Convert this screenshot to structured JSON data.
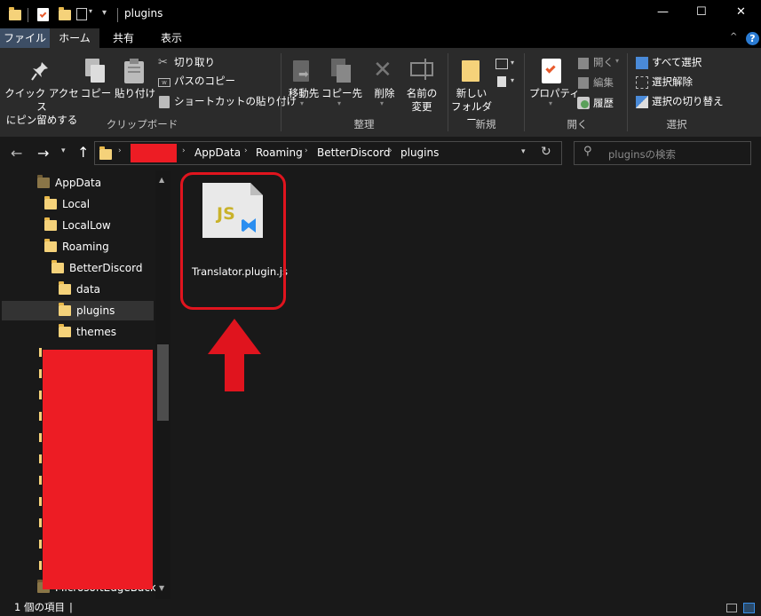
{
  "window": {
    "title": "plugins",
    "minimize": "—",
    "maximize": "☐",
    "close": "✕"
  },
  "tabs": {
    "file": "ファイル",
    "home": "ホーム",
    "share": "共有",
    "view": "表示"
  },
  "ribbon": {
    "clipboard": {
      "pin_label": "クイック アクセス\nにピン留めする",
      "copy": "コピー",
      "paste": "貼り付け",
      "cut": "切り取り",
      "copy_path": "パスのコピー",
      "paste_shortcut": "ショートカットの貼り付け",
      "group": "クリップボード"
    },
    "organize": {
      "move_to": "移動先",
      "copy_to": "コピー先",
      "delete": "削除",
      "rename": "名前の\n変更",
      "group": "整理"
    },
    "new": {
      "new_folder": "新しい\nフォルダー",
      "group": "新規"
    },
    "open": {
      "properties": "プロパティ",
      "open": "開く",
      "edit": "編集",
      "history": "履歴",
      "group": "開く"
    },
    "select": {
      "select_all": "すべて選択",
      "select_none": "選択解除",
      "invert": "選択の切り替え",
      "group": "選択"
    }
  },
  "address": {
    "path": [
      "AppData",
      "Roaming",
      "BetterDiscord",
      "plugins"
    ],
    "search_placeholder": "pluginsの検索"
  },
  "tree": {
    "items": [
      {
        "label": "AppData"
      },
      {
        "label": "Local"
      },
      {
        "label": "LocalLow"
      },
      {
        "label": "Roaming"
      },
      {
        "label": "BetterDiscord"
      },
      {
        "label": "data"
      },
      {
        "label": "plugins"
      },
      {
        "label": "themes"
      }
    ],
    "partial_bottom": "MicrosoftEdgeBackup"
  },
  "file": {
    "name": "Translator.plugin.js",
    "icon_text": "JS"
  },
  "status": {
    "count": "1 個の項目",
    "sep": "|"
  },
  "colors": {
    "redaction": "#ed1c24",
    "annotation": "#e0141e",
    "accent": "#0078d7"
  }
}
